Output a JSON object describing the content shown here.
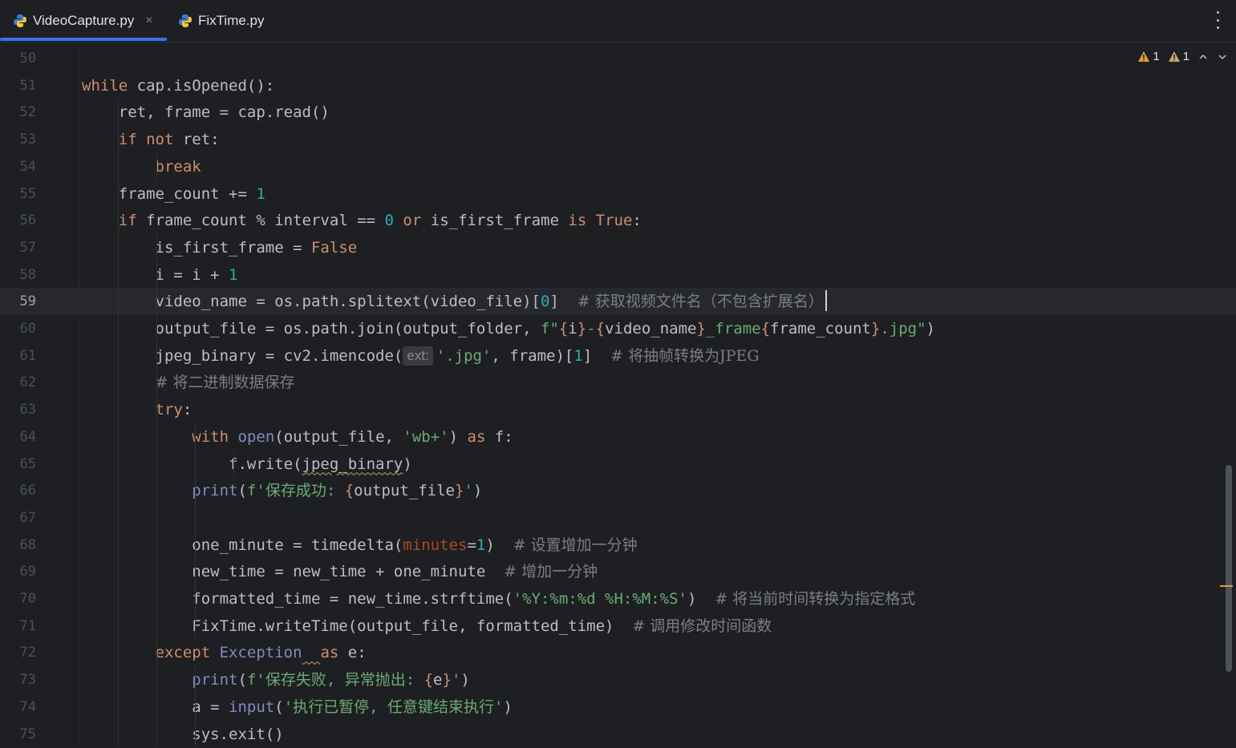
{
  "tabs": [
    {
      "label": "VideoCapture.py",
      "active": true,
      "close": "×"
    },
    {
      "label": "FixTime.py",
      "active": false
    }
  ],
  "inspections": {
    "warnings": "1",
    "weak_warnings": "1"
  },
  "colors": {
    "keyword": "#cf8e6d",
    "number": "#2aacb8",
    "string": "#6aab73",
    "comment": "#7a7e85",
    "builtin": "#8888c6",
    "accent": "#3574f0",
    "warning": "#e0a135"
  },
  "current_line": "59",
  "lines": [
    {
      "n": "50",
      "p": []
    },
    {
      "n": "51",
      "p": [
        [
          "kw",
          "while"
        ],
        [
          "t",
          " cap.isOpened():"
        ]
      ]
    },
    {
      "n": "52",
      "p": [
        [
          "t",
          "    ret, frame = cap.read()"
        ]
      ]
    },
    {
      "n": "53",
      "p": [
        [
          "t",
          "    "
        ],
        [
          "kw",
          "if not"
        ],
        [
          "t",
          " ret:"
        ]
      ]
    },
    {
      "n": "54",
      "p": [
        [
          "t",
          "        "
        ],
        [
          "kw",
          "break"
        ]
      ]
    },
    {
      "n": "55",
      "p": [
        [
          "t",
          "    frame_count += "
        ],
        [
          "num",
          "1"
        ]
      ]
    },
    {
      "n": "56",
      "p": [
        [
          "t",
          "    "
        ],
        [
          "kw",
          "if"
        ],
        [
          "t",
          " frame_count % interval == "
        ],
        [
          "num",
          "0"
        ],
        [
          "t",
          " "
        ],
        [
          "kw",
          "or"
        ],
        [
          "t",
          " is_first_frame "
        ],
        [
          "kw",
          "is True"
        ],
        [
          "t",
          ":"
        ]
      ]
    },
    {
      "n": "57",
      "p": [
        [
          "t",
          "        is_first_frame = "
        ],
        [
          "kw",
          "False"
        ]
      ]
    },
    {
      "n": "58",
      "p": [
        [
          "t",
          "        i = i + "
        ],
        [
          "num",
          "1"
        ]
      ]
    },
    {
      "n": "59",
      "p": [
        [
          "t",
          "        video_name = os.path.splitext(video_file)["
        ],
        [
          "num",
          "0"
        ],
        [
          "t",
          "]  "
        ],
        [
          "cmt",
          "# 获取视频文件名（不包含扩展名）"
        ],
        [
          "caret",
          ""
        ]
      ]
    },
    {
      "n": "60",
      "p": [
        [
          "t",
          "        output_file = os.path.join(output_folder, "
        ],
        [
          "str",
          "f\""
        ],
        [
          "kw",
          "{"
        ],
        [
          "t",
          "i"
        ],
        [
          "kw",
          "}"
        ],
        [
          "str",
          "-"
        ],
        [
          "kw",
          "{"
        ],
        [
          "t",
          "video_name"
        ],
        [
          "kw",
          "}"
        ],
        [
          "str",
          "_frame"
        ],
        [
          "kw",
          "{"
        ],
        [
          "t",
          "frame_count"
        ],
        [
          "kw",
          "}"
        ],
        [
          "str",
          ".jpg\""
        ],
        [
          "t",
          ")"
        ]
      ]
    },
    {
      "n": "61",
      "p": [
        [
          "t",
          "        jpeg_binary = cv2.imencode("
        ],
        [
          "hint",
          "ext:"
        ],
        [
          "str",
          "'.jpg'"
        ],
        [
          "t",
          ", frame)["
        ],
        [
          "num",
          "1"
        ],
        [
          "t",
          "]  "
        ],
        [
          "cmt",
          "# 将抽帧转换为JPEG"
        ]
      ]
    },
    {
      "n": "62",
      "p": [
        [
          "t",
          "        "
        ],
        [
          "cmt",
          "# 将二进制数据保存"
        ]
      ]
    },
    {
      "n": "63",
      "p": [
        [
          "t",
          "        "
        ],
        [
          "kw",
          "try"
        ],
        [
          "t",
          ":"
        ]
      ]
    },
    {
      "n": "64",
      "p": [
        [
          "t",
          "            "
        ],
        [
          "kw",
          "with"
        ],
        [
          "t",
          " "
        ],
        [
          "builtin",
          "open"
        ],
        [
          "t",
          "(output_file, "
        ],
        [
          "str",
          "'wb+'"
        ],
        [
          "t",
          ") "
        ],
        [
          "kw",
          "as"
        ],
        [
          "t",
          " f:"
        ]
      ]
    },
    {
      "n": "65",
      "p": [
        [
          "t",
          "                f.write("
        ],
        [
          "sq",
          "jpeg_binary"
        ],
        [
          "t",
          ")"
        ]
      ]
    },
    {
      "n": "66",
      "p": [
        [
          "t",
          "            "
        ],
        [
          "builtin",
          "print"
        ],
        [
          "t",
          "("
        ],
        [
          "str",
          "f'保存成功: "
        ],
        [
          "kw",
          "{"
        ],
        [
          "t",
          "output_file"
        ],
        [
          "kw",
          "}"
        ],
        [
          "str",
          "'"
        ],
        [
          "t",
          ")"
        ]
      ]
    },
    {
      "n": "67",
      "p": []
    },
    {
      "n": "68",
      "p": [
        [
          "t",
          "            one_minute = timedelta("
        ],
        [
          "param",
          "minutes"
        ],
        [
          "t",
          "="
        ],
        [
          "num",
          "1"
        ],
        [
          "t",
          ")  "
        ],
        [
          "cmt",
          "# 设置增加一分钟"
        ]
      ]
    },
    {
      "n": "69",
      "p": [
        [
          "t",
          "            new_time = new_time + one_minute  "
        ],
        [
          "cmt",
          "# 增加一分钟"
        ]
      ]
    },
    {
      "n": "70",
      "p": [
        [
          "t",
          "            formatted_time = new_time.strftime("
        ],
        [
          "str",
          "'%Y:%m:%d %H:%M:%S'"
        ],
        [
          "t",
          ")  "
        ],
        [
          "cmt",
          "# 将当前时间转换为指定格式"
        ]
      ]
    },
    {
      "n": "71",
      "p": [
        [
          "t",
          "            FixTime.writeTime(output_file, formatted_time)  "
        ],
        [
          "cmt",
          "# 调用修改时间函数"
        ]
      ]
    },
    {
      "n": "72",
      "p": [
        [
          "t",
          "        "
        ],
        [
          "kw",
          "except"
        ],
        [
          "t",
          " "
        ],
        [
          "builtin",
          "Exception"
        ],
        [
          "sq",
          "  "
        ],
        [
          "kw",
          "as"
        ],
        [
          "t",
          " e:"
        ]
      ]
    },
    {
      "n": "73",
      "p": [
        [
          "t",
          "            "
        ],
        [
          "builtin",
          "print"
        ],
        [
          "t",
          "("
        ],
        [
          "str",
          "f'保存失败, 异常抛出: "
        ],
        [
          "kw",
          "{"
        ],
        [
          "t",
          "e"
        ],
        [
          "kw",
          "}"
        ],
        [
          "str",
          "'"
        ],
        [
          "t",
          ")"
        ]
      ]
    },
    {
      "n": "74",
      "p": [
        [
          "t",
          "            a = "
        ],
        [
          "builtin",
          "input"
        ],
        [
          "t",
          "("
        ],
        [
          "str",
          "'执行已暂停, 任意键结束执行'"
        ],
        [
          "t",
          ")"
        ]
      ]
    },
    {
      "n": "75",
      "p": [
        [
          "t",
          "            sys.exit()"
        ]
      ]
    }
  ]
}
